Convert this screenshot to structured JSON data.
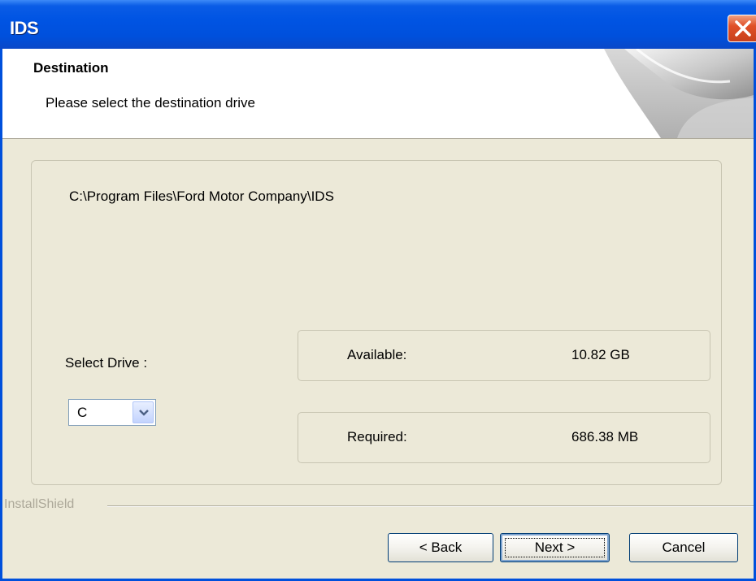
{
  "window": {
    "title": "IDS",
    "close_icon": "close-icon"
  },
  "header": {
    "title": "Destination",
    "subtitle": "Please select the destination drive"
  },
  "main": {
    "install_path": "C:\\Program Files\\Ford Motor Company\\IDS",
    "select_drive_label": "Select Drive :",
    "drive_value": "C",
    "available_label": "Available:",
    "available_value": "10.82 GB",
    "required_label": "Required:",
    "required_value": "686.38 MB"
  },
  "footer": {
    "brand": "InstallShield",
    "back_label": "< Back",
    "next_label": "Next >",
    "cancel_label": "Cancel"
  },
  "colors": {
    "titlebar": "#0054e3",
    "dialog_bg": "#ece9d8",
    "close_button": "#e05028"
  }
}
